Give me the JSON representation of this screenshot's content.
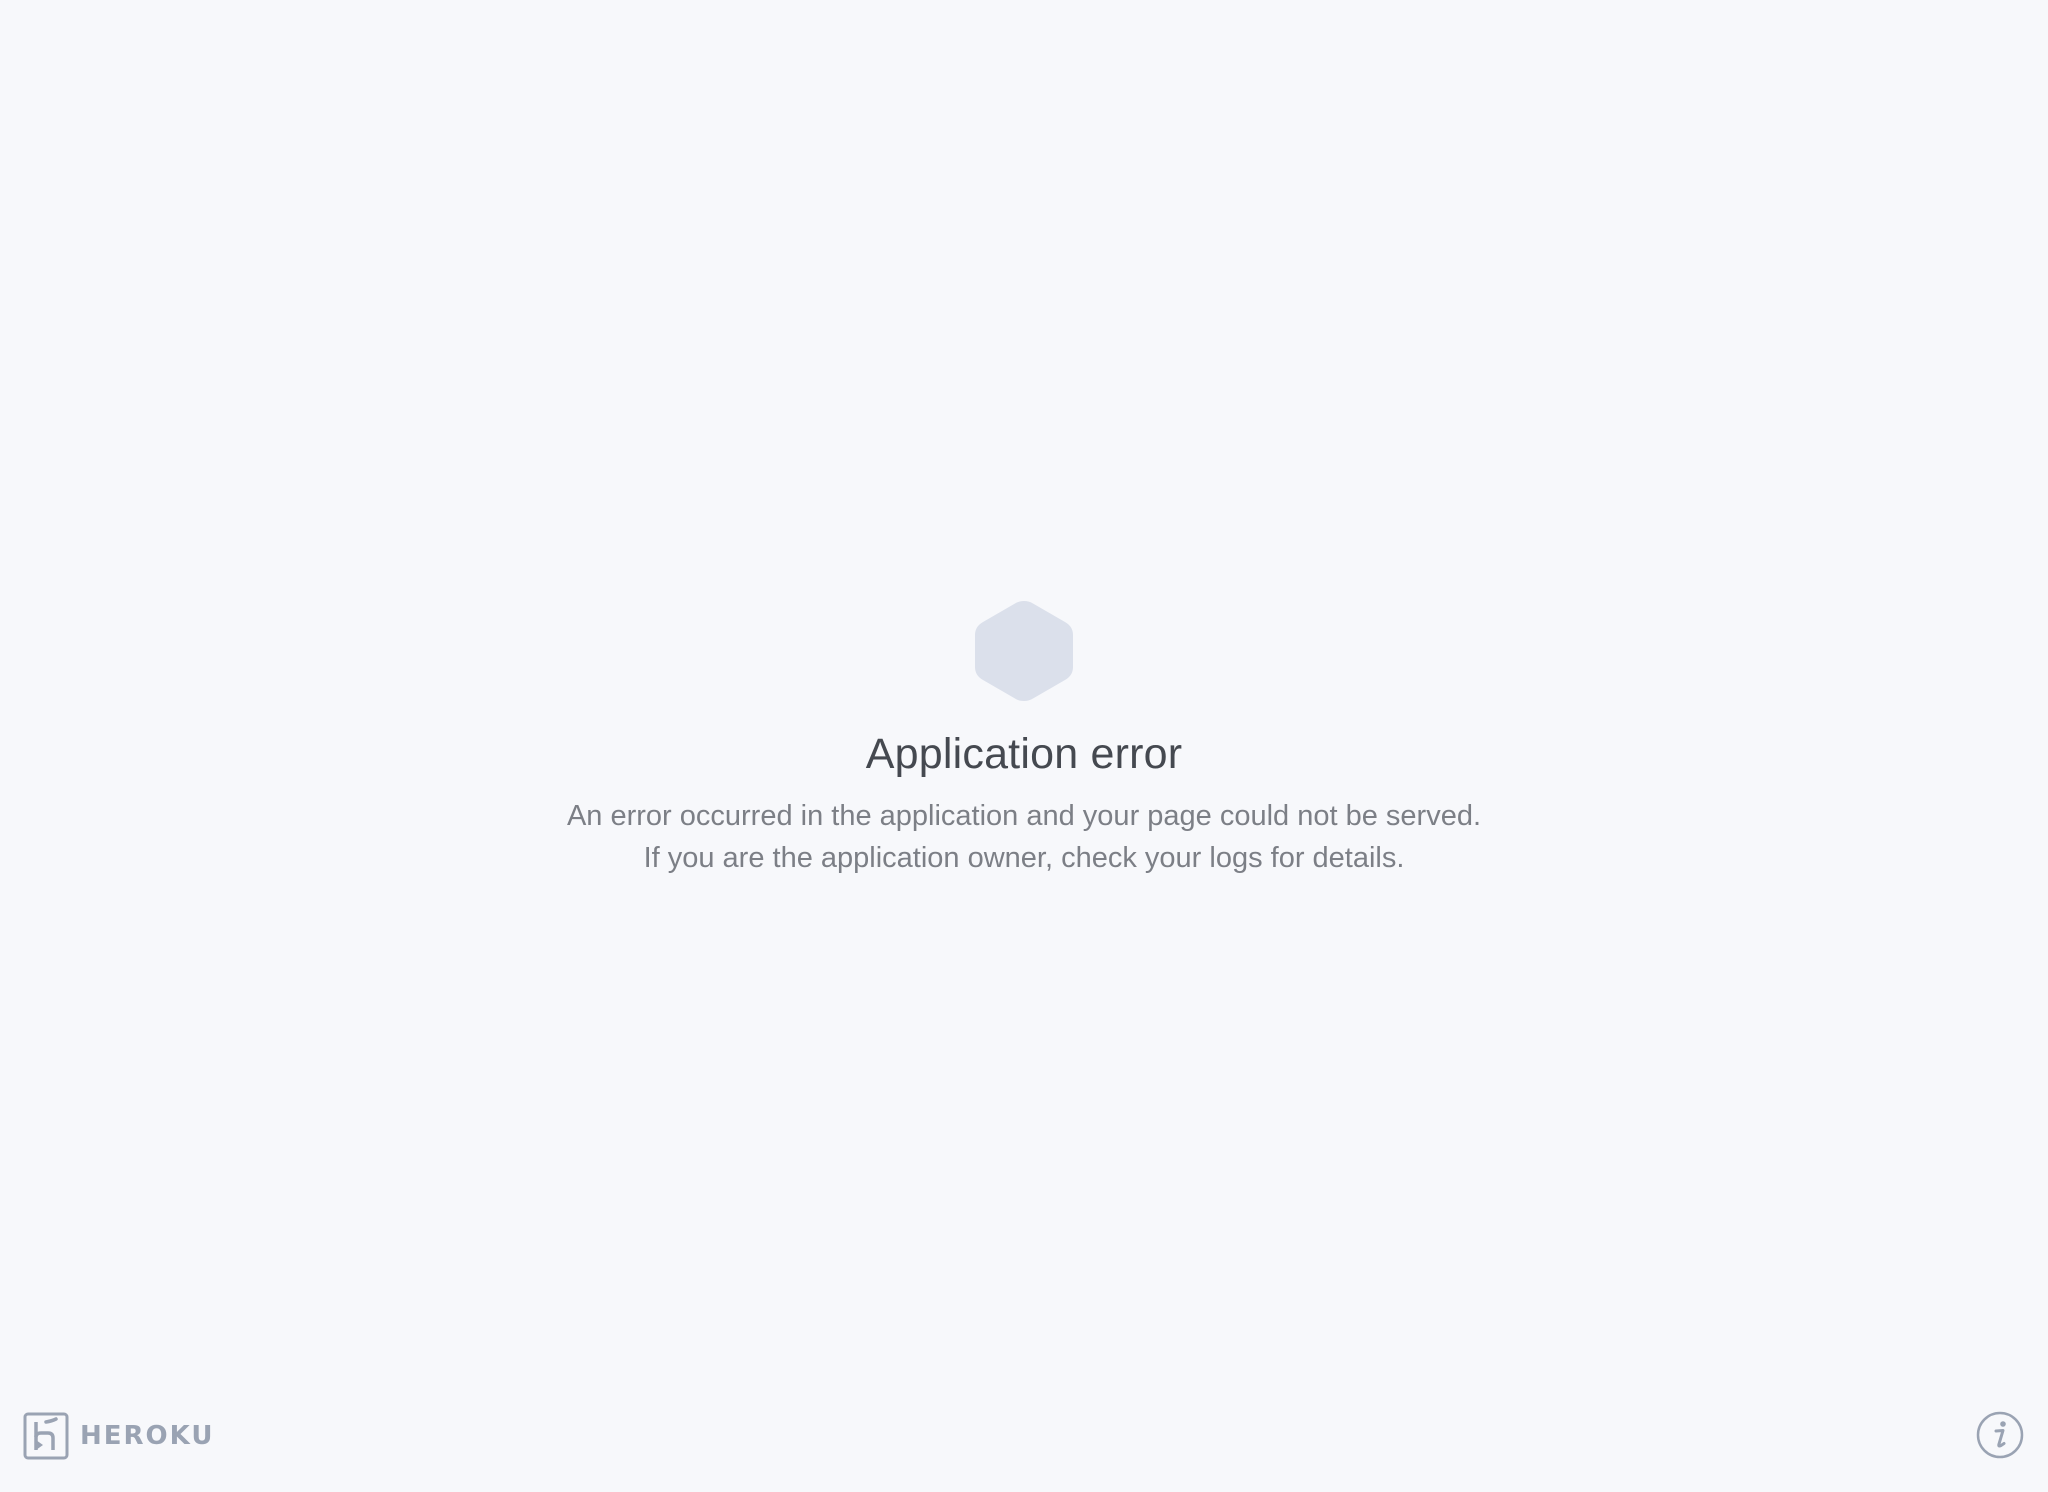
{
  "error": {
    "title": "Application error",
    "message": "An error occurred in the application and your page could not be served. If you are the application owner, check your logs for details.",
    "icon": "hexagon-icon"
  },
  "footer": {
    "brand": "HEROKU",
    "logo_icon": "heroku-logo-icon",
    "info_icon": "info-icon"
  },
  "colors": {
    "background": "#f7f8fb",
    "hexagon": "#dbe0eb",
    "title": "#454950",
    "message": "#7c7f86",
    "brand": "#9aa3b3"
  }
}
